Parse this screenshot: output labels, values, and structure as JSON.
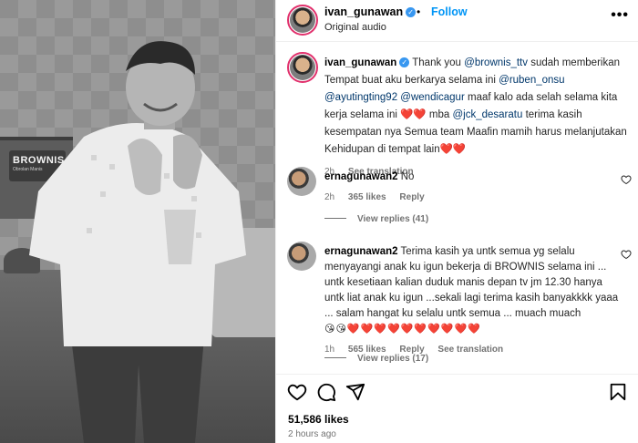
{
  "media": {
    "show_logo": "BROWNIS",
    "show_logo_sub": "Obrolan Manis"
  },
  "header": {
    "username": "ivan_gunawan",
    "verified_icon": "✓",
    "dot": "•",
    "follow_label": "Follow",
    "audio_label": "Original audio",
    "more_icon": "more-options-icon"
  },
  "caption": {
    "username": "ivan_gunawan",
    "text_1": "Thank you",
    "mention_1": "@brownis_ttv",
    "text_2": "sudah memberikan Tempat buat aku berkarya selama ini",
    "mention_2": "@ruben_onsu",
    "mention_3": "@ayutingting92",
    "mention_4": "@wendicagur",
    "text_3": "maaf kalo ada selah selama kita kerja selama ini ❤️❤️ mba",
    "mention_5": "@jck_desaratu",
    "text_4": "terima kasih kesempatan nya Semua team Maafin mamih harus melanjutakan Kehidupan di tempat lain❤️❤️",
    "time": "2h",
    "see_translation": "See translation"
  },
  "comments": [
    {
      "username": "ernagunawan2",
      "text": "No",
      "time": "2h",
      "likes": "365 likes",
      "reply": "Reply",
      "view_replies": "View replies (41)"
    },
    {
      "username": "ernagunawan2",
      "text": "Terima kasih ya untk semua yg selalu menyayangi anak ku igun bekerja di BROWNIS selama ini ... untk kesetiaan kalian duduk manis depan tv jm 12.30 hanya untk liat anak ku igun ...sekali lagi terima kasih banyakkkk yaaa ... salam hangat ku selalu untk semua ... muach muach",
      "emojis": "😘😘❤️❤️❤️❤️❤️❤️❤️❤️❤️❤️",
      "time": "1h",
      "likes": "565 likes",
      "reply": "Reply",
      "see_translation": "See translation",
      "view_replies": "View replies (17)"
    }
  ],
  "actions": {
    "likes": "51,586 likes",
    "time": "2 hours ago"
  }
}
